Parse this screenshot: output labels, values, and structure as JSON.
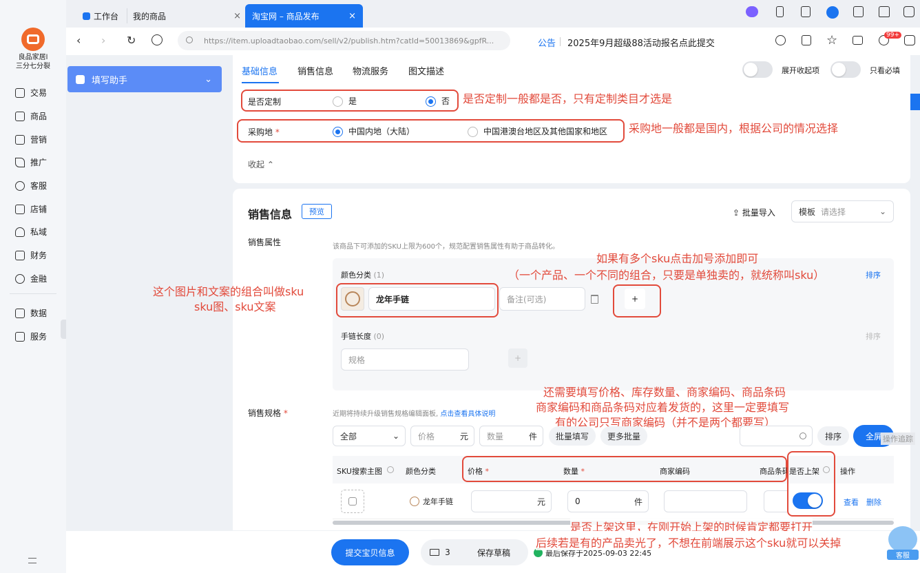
{
  "app": {
    "shop_name_line1": "良品家居l",
    "shop_name_line2": "三分七分裂"
  },
  "tabs": [
    {
      "label": "工作台"
    },
    {
      "label": "我的商品"
    },
    {
      "label": "淘宝网 – 商品发布"
    }
  ],
  "address": {
    "url": "https://item.uploadtaobao.com/sell/v2/publish.htm?catId=50013869&gpfR...",
    "notice_label": "公告",
    "notice_text": "2025年9月超级88活动报名点此提交",
    "badge": "99+"
  },
  "nav": {
    "items": [
      "交易",
      "商品",
      "营销",
      "推广",
      "客服",
      "店铺",
      "私域",
      "财务",
      "金融",
      "数据",
      "服务"
    ]
  },
  "helper": {
    "label": "填写助手"
  },
  "section_tabs": [
    "基础信息",
    "销售信息",
    "物流服务",
    "图文描述"
  ],
  "toggles": {
    "expand_label": "展开收起项",
    "required_label": "只看必填"
  },
  "basic": {
    "custom_label": "是否定制",
    "custom_yes": "是",
    "custom_no": "否",
    "origin_label": "采购地",
    "origin_required": "*",
    "origin_cn": "中国内地（大陆）",
    "origin_other": "中国港澳台地区及其他国家和地区",
    "collapse": "收起"
  },
  "sales": {
    "title": "销售信息",
    "preview": "预览",
    "batch_import": "批量导入",
    "template_label": "模板",
    "template_placeholder": "请选择",
    "attr_label": "销售属性",
    "attr_hint": "该商品下可添加的SKU上限为600个，规范配置销售属性有助于商品转化。",
    "color_label": "颜色分类",
    "color_count": "(1)",
    "sort": "排序",
    "color_value": "龙年手链",
    "note_placeholder": "备注(可选)",
    "add": "+",
    "length_label": "手链长度",
    "length_count": "(0)",
    "length_placeholder": "规格",
    "spec_label": "销售规格",
    "spec_hint": "近期将持续升级销售规格编辑面板,",
    "spec_link": "点击查看具体说明",
    "filter_all": "全部",
    "price_placeholder": "价格",
    "price_unit": "元",
    "qty_placeholder": "数量",
    "qty_unit": "件",
    "batch_fill": "批量填写",
    "more_batch": "更多批量",
    "sort_btn": "排序",
    "fullscreen": "全屏",
    "trace": "操作追踪"
  },
  "table": {
    "headers": [
      "SKU搜索主图",
      "颜色分类",
      "价格",
      "数量",
      "商家编码",
      "商品条码",
      "是否上架",
      "操作"
    ],
    "row": {
      "color": "龙年手链",
      "price_unit": "元",
      "qty": "0",
      "qty_unit": "件",
      "view": "查看",
      "delete": "删除"
    }
  },
  "footer": {
    "submit": "提交宝贝信息",
    "mail_count": "3",
    "save_draft": "保存草稿",
    "last_saved": "最后保存于2025-09-03 22:45",
    "service": "客服"
  },
  "annotations": {
    "custom": "是否定制一般都是否，只有定制类目才选是",
    "origin": "采购地一般都是国内，根据公司的情况选择",
    "sku_add_1": "如果有多个sku点击加号添加即可",
    "sku_add_2": "（一个产品、一个不同的组合，只要是单独卖的，就统称叫sku）",
    "sku_img_1": "这个图片和文案的组合叫做sku",
    "sku_img_2": "sku图、sku文案",
    "price_1": "还需要填写价格、库存数量、商家编码、商品条码",
    "price_2": "商家编码和商品条码对应着发货的，这里一定要填写",
    "price_3": "有的公司只写商家编码（并不是两个都要写）",
    "shelf_1": "是否上架这里，在刚开始上架的时候肯定都要打开",
    "shelf_2": "后续若是有的产品卖光了，不想在前端展示这个sku就可以关掉"
  },
  "colors": {
    "accent": "#1b74f0",
    "annotation": "#e24a3b"
  }
}
